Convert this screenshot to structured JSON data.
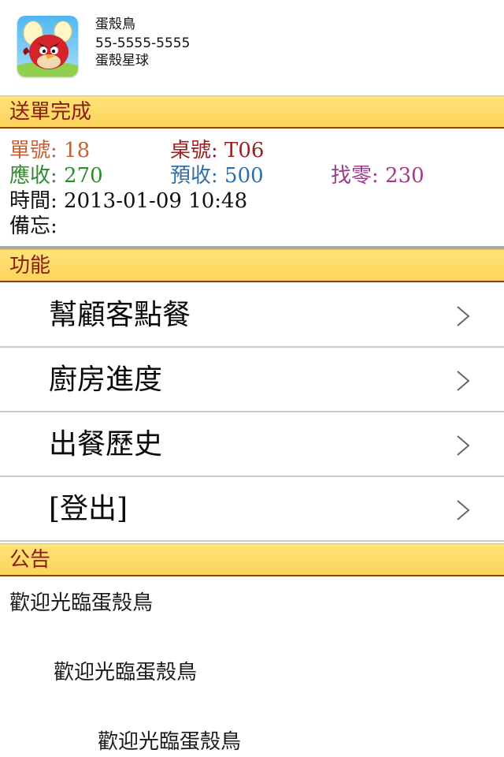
{
  "shop": {
    "name": "蛋殼鳥",
    "phone": "55-5555-5555",
    "planet": "蛋殼星球",
    "logo_icon": "angry-bird-egg-icon"
  },
  "order_section": {
    "title": "送單完成",
    "order_no": "單號: 18",
    "table_no": "桌號: T06",
    "due": "應收: 270",
    "prepaid": "預收: 500",
    "change": "找零: 230",
    "time": "時間: 2013-01-09 10:48",
    "memo": "備忘:",
    "colors": {
      "order_no": "#c0633a",
      "table_no": "#9a1f1f",
      "due": "#2f8a2f",
      "prepaid": "#2d6fa8",
      "change": "#a03a8a"
    }
  },
  "function_section": {
    "title": "功能",
    "items": [
      {
        "label": "幫顧客點餐",
        "icon": "chevron-right-icon"
      },
      {
        "label": "廚房進度",
        "icon": "chevron-right-icon"
      },
      {
        "label": "出餐歷史",
        "icon": "chevron-right-icon"
      },
      {
        "label": "[登出]",
        "icon": "chevron-right-icon"
      }
    ]
  },
  "announcement_section": {
    "title": "公告",
    "lines": [
      "歡迎光臨蛋殼鳥",
      "歡迎光臨蛋殼鳥",
      "歡迎光臨蛋殼鳥"
    ]
  },
  "theme": {
    "bar_yellow": "#fcd45a",
    "bar_border": "#9a3c05",
    "bar_text": "#8a1b0c"
  }
}
